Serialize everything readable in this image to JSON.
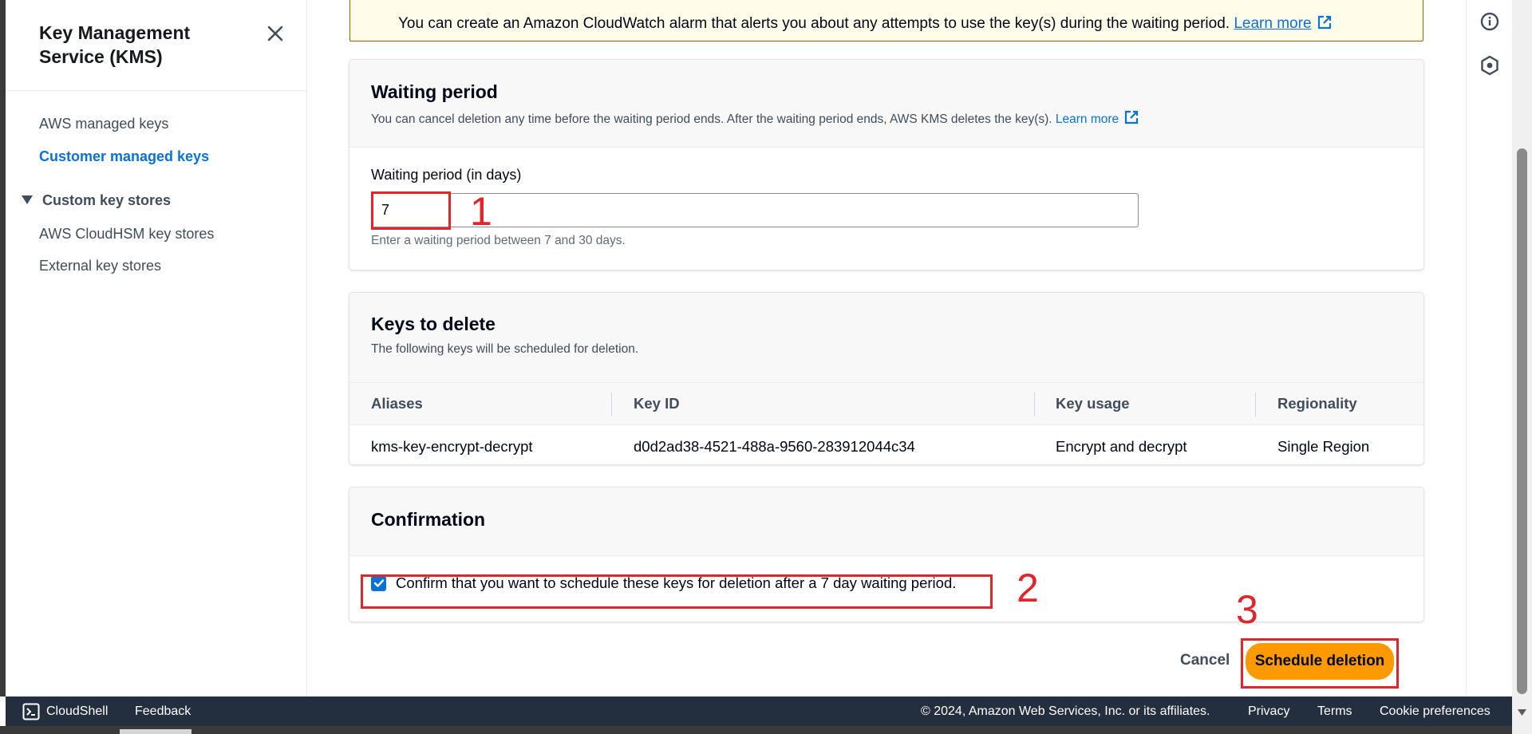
{
  "sidebar": {
    "title": "Key Management Service (KMS)",
    "items": [
      {
        "label": "AWS managed keys"
      },
      {
        "label": "Customer managed keys"
      }
    ],
    "section": {
      "label": "Custom key stores",
      "items": [
        {
          "label": "AWS CloudHSM key stores"
        },
        {
          "label": "External key stores"
        }
      ]
    }
  },
  "alert": {
    "text": "You can create an Amazon CloudWatch alarm that alerts you about any attempts to use the key(s) during the waiting period.",
    "link": "Learn more"
  },
  "waiting_period": {
    "title": "Waiting period",
    "description": "You can cancel deletion any time before the waiting period ends. After the waiting period ends, AWS KMS deletes the key(s).",
    "link": "Learn more",
    "field_label": "Waiting period (in days)",
    "value": "7",
    "hint": "Enter a waiting period between 7 and 30 days."
  },
  "keys_to_delete": {
    "title": "Keys to delete",
    "description": "The following keys will be scheduled for deletion.",
    "columns": [
      "Aliases",
      "Key ID",
      "Key usage",
      "Regionality"
    ],
    "rows": [
      [
        "kms-key-encrypt-decrypt",
        "d0d2ad38-4521-488a-9560-283912044c34",
        "Encrypt and decrypt",
        "Single Region"
      ]
    ]
  },
  "confirmation": {
    "title": "Confirmation",
    "checkbox_label": "Confirm that you want to schedule these keys for deletion after a 7 day waiting period.",
    "checked": true
  },
  "actions": {
    "cancel": "Cancel",
    "primary": "Schedule deletion"
  },
  "annotations": [
    "1",
    "2",
    "3"
  ],
  "footer": {
    "cloudshell": "CloudShell",
    "feedback": "Feedback",
    "copyright": "© 2024, Amazon Web Services, Inc. or its affiliates.",
    "privacy": "Privacy",
    "terms": "Terms",
    "cookies": "Cookie preferences"
  },
  "icons": {
    "close": "close-icon",
    "section_toggle": "caret-down-icon",
    "external_link": "external-link-icon",
    "info": "info-icon",
    "support": "hexagon-icon",
    "cloudshell": "terminal-icon"
  },
  "colors": {
    "accent": "#0972d3",
    "primary_button": "#ff9900",
    "annotation": "#e0262b",
    "footer_bg": "#232f3e",
    "alert_bg": "#fffce9"
  }
}
